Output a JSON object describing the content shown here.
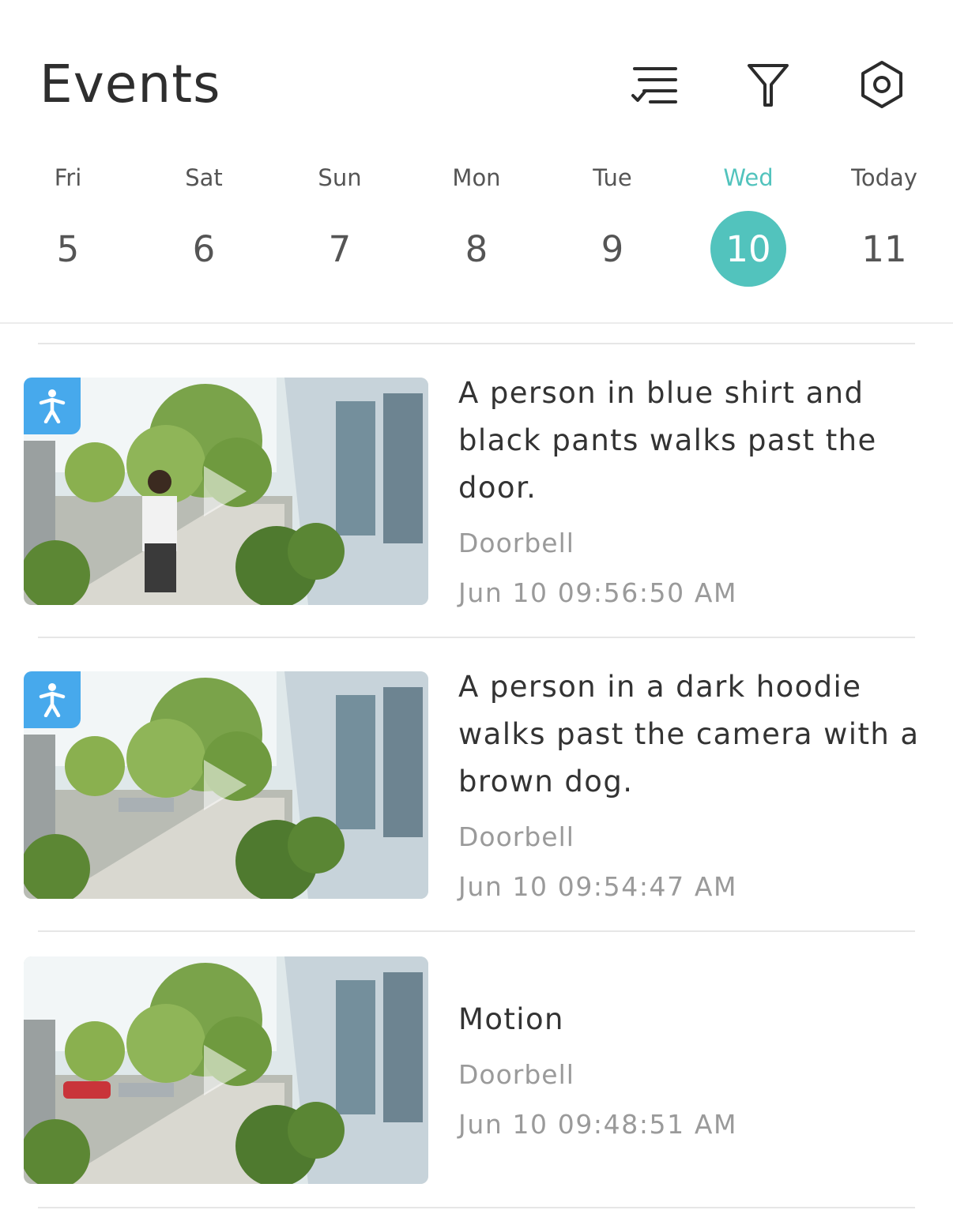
{
  "header": {
    "title": "Events",
    "icons": [
      "checklist-icon",
      "filter-icon",
      "settings-icon"
    ]
  },
  "days": [
    {
      "name": "Fri",
      "num": "5"
    },
    {
      "name": "Sat",
      "num": "6"
    },
    {
      "name": "Sun",
      "num": "7"
    },
    {
      "name": "Mon",
      "num": "8"
    },
    {
      "name": "Tue",
      "num": "9"
    },
    {
      "name": "Wed",
      "num": "10",
      "selected": true
    },
    {
      "name": "Today",
      "num": "11"
    }
  ],
  "events": [
    {
      "title": "A person in blue shirt and black pants walks past the door.",
      "source": "Doorbell",
      "time": "Jun 10 09:56:50 AM",
      "badge": "person-icon"
    },
    {
      "title": "A person in a dark hoodie walks past the camera with a brown dog.",
      "source": "Doorbell",
      "time": "Jun 10 09:54:47 AM",
      "badge": "person-icon"
    },
    {
      "title": "Motion",
      "source": "Doorbell",
      "time": "Jun 10 09:48:51 AM",
      "badge": ""
    }
  ],
  "colors": {
    "accent": "#52c3bd",
    "badge": "#47a9ec",
    "text": "#333333",
    "muted": "#9a9a9a"
  }
}
